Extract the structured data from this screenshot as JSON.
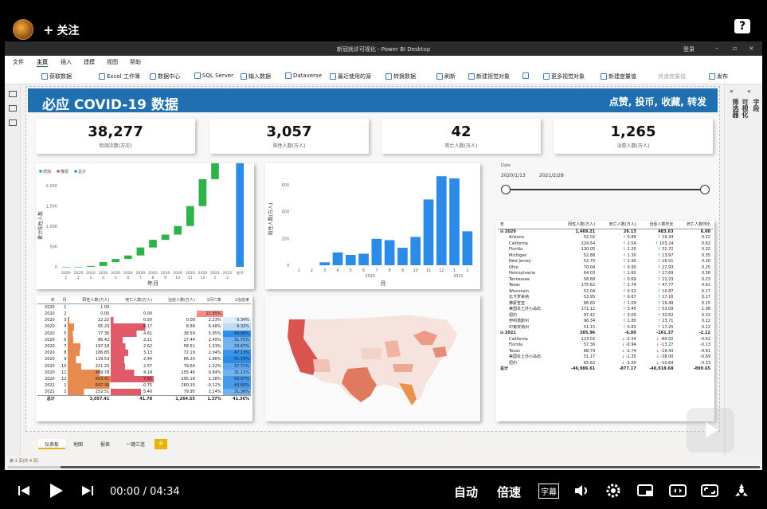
{
  "player": {
    "follow_label": "关注",
    "help": "?",
    "time_current": "00:00",
    "time_sep": "/",
    "time_total": "04:34",
    "auto_label": "自动",
    "speed_label": "倍速",
    "subtitle_label": "字幕",
    "progress_fraction": 0.07
  },
  "window": {
    "title": "新冠就诊可视化 - Power BI Desktop",
    "login": "登录"
  },
  "menu": [
    "文件",
    "主页",
    "插入",
    "建模",
    "视图",
    "帮助"
  ],
  "ribbon": [
    "获取数据",
    "Excel 工作簿",
    "数据中心",
    "SQL Server",
    "输入数据",
    "Dataverse",
    "最近使用的源",
    "转换数据",
    "刷新",
    "新建视觉对象",
    "文本框",
    "更多视觉对象",
    "新建度量值",
    "快速度量值",
    "发布"
  ],
  "right_pane": {
    "viz": "可视化",
    "filters": "筛选器",
    "fields": "字段"
  },
  "dashboard": {
    "title": "必应 COVID-19 数据",
    "cta": "点赞, 投币, 收藏, 转发",
    "kpis": [
      {
        "value": "38,277",
        "label": "检测次数(万次)"
      },
      {
        "value": "3,057",
        "label": "阳性人数(万人)"
      },
      {
        "value": "42",
        "label": "死亡人数(万人)"
      },
      {
        "value": "1,265",
        "label": "治愈人数(万人)"
      }
    ]
  },
  "chart_data": [
    {
      "type": "bar",
      "subtype": "waterfall",
      "legend": [
        "增加",
        "降低",
        "总计"
      ],
      "colors": {
        "increase": "#2fb24a",
        "decrease": "#d9534f",
        "total": "#2b8be6"
      },
      "categories": [
        "2020 1",
        "2020 2",
        "2020 3",
        "2020 4",
        "2020 5",
        "2020 6",
        "2020 7",
        "2020 8",
        "2020 9",
        "2020 10",
        "2020 11",
        "2020 12",
        "2021 1",
        "2021 2",
        "总计"
      ],
      "values": [
        0,
        0,
        22,
        95,
        77,
        86,
        197,
        187,
        130,
        211,
        490,
        663,
        647,
        253,
        3057
      ],
      "xlabel": "年月",
      "ylabel": "累计阳性人数",
      "yticks": [
        "0",
        "500",
        "1,000",
        "1,500",
        "2,000"
      ],
      "ylim": [
        0,
        2000
      ]
    },
    {
      "type": "bar",
      "categories": [
        "2020 1",
        "2020 2",
        "2020 3",
        "2020 4",
        "2020 5",
        "2020 6",
        "2020 7",
        "2020 8",
        "2020 9",
        "2020 10",
        "2020 11",
        "2020 12",
        "2021 1",
        "2021 2"
      ],
      "values": [
        0,
        0,
        22,
        95,
        77,
        86,
        197,
        187,
        130,
        211,
        490,
        663,
        647,
        253
      ],
      "xlabel": "月",
      "ylabel": "阳性人数(万人)",
      "xgroups": [
        "2020",
        "2021"
      ],
      "yticks": [
        "0",
        "200",
        "400",
        "600"
      ],
      "ylim": [
        0,
        700
      ],
      "color": "#2b8be6"
    }
  ],
  "slicer": {
    "label": "Date",
    "from": "2020/1/13",
    "to": "2021/2/28"
  },
  "monthly_table": {
    "headers": [
      "年",
      "月",
      "阳性人数(万人)",
      "死亡人数(万人)",
      "治愈人数(万人)",
      "1月亡率",
      "1治愈率"
    ],
    "rows": [
      [
        "2020",
        "1",
        "1.00",
        "",
        "",
        "",
        ""
      ],
      [
        "2020",
        "2",
        "0.00",
        "0.00",
        "",
        "21.85%",
        ""
      ],
      [
        "2020",
        "3",
        "22.22",
        "0.50",
        "0.08",
        "2.23%",
        "0.34%"
      ],
      [
        "2020",
        "4",
        "95.29",
        "6.17",
        "8.88",
        "6.48%",
        "9.32%"
      ],
      [
        "2020",
        "5",
        "77.36",
        "4.61",
        "38.59",
        "5.95%",
        "49.89%"
      ],
      [
        "2020",
        "6",
        "86.42",
        "2.11",
        "27.44",
        "2.45%",
        "31.75%"
      ],
      [
        "2020",
        "7",
        "197.18",
        "2.62",
        "58.51",
        "1.33%",
        "29.67%"
      ],
      [
        "2020",
        "8",
        "186.85",
        "3.13",
        "72.19",
        "2.04%",
        "47.13%"
      ],
      [
        "2020",
        "9",
        "129.53",
        "2.44",
        "66.25",
        "1.88%",
        "51.14%"
      ],
      [
        "2020",
        "10",
        "211.20",
        "2.57",
        "79.64",
        "1.22%",
        "37.71%"
      ],
      [
        "2020",
        "11",
        "489.78",
        "4.19",
        "155.46",
        "0.84%",
        "31.11%"
      ],
      [
        "2020",
        "12",
        "663.41",
        "7.65",
        "295.18",
        "1.28%",
        "43.07%"
      ],
      [
        "2021",
        "1",
        "647.30",
        "-0.75",
        "280.15",
        "-0.12%",
        "43.60%"
      ],
      [
        "2021",
        "2",
        "252.51",
        "5.40",
        "79.95",
        "2.14%",
        "31.36%"
      ]
    ],
    "total": [
      "总计",
      "",
      "3,057.41",
      "41.78",
      "1,264.55",
      "1.37%",
      "41.36%"
    ]
  },
  "region_table": {
    "headers": [
      "年",
      "阳性人数(万人)",
      "死亡人数(万人)",
      "治愈人数环比",
      "死亡人数环比"
    ],
    "rows": [
      {
        "name": "2020",
        "year": true,
        "v": [
          "1,469.21",
          "26.13",
          "483.63",
          "6.00"
        ],
        "d": [
          "",
          "",
          "",
          ""
        ]
      },
      {
        "name": "Arizona",
        "v": [
          "52.02",
          "0.89",
          "19.34",
          "0.22"
        ],
        "d": [
          "",
          "up",
          "up",
          ""
        ]
      },
      {
        "name": "California",
        "v": [
          "224.54",
          "2.54",
          "103.24",
          "0.62"
        ],
        "d": [
          "",
          "up",
          "up",
          ""
        ]
      },
      {
        "name": "Florida",
        "v": [
          "130.05",
          "2.20",
          "31.72",
          "0.32"
        ],
        "d": [
          "",
          "up",
          "up",
          ""
        ]
      },
      {
        "name": "Michigan",
        "v": [
          "52.88",
          "1.30",
          "13.97",
          "0.35"
        ],
        "d": [
          "",
          "up",
          "up",
          ""
        ]
      },
      {
        "name": "New Jersey",
        "v": [
          "52.70",
          "1.90",
          "16.01",
          "0.20"
        ],
        "d": [
          "",
          "up",
          "up",
          ""
        ]
      },
      {
        "name": "Ohio",
        "v": [
          "70.04",
          "0.90",
          "27.93",
          "0.25"
        ],
        "d": [
          "",
          "up",
          "up",
          ""
        ]
      },
      {
        "name": "Pennsylvania",
        "v": [
          "64.03",
          "1.60",
          "27.69",
          "0.56"
        ],
        "d": [
          "",
          "up",
          "up",
          ""
        ]
      },
      {
        "name": "Tennessee",
        "v": [
          "58.68",
          "0.69",
          "21.23",
          "0.23"
        ],
        "d": [
          "",
          "up",
          "up",
          ""
        ]
      },
      {
        "name": "Texas",
        "v": [
          "175.62",
          "2.74",
          "47.77",
          "0.61"
        ],
        "d": [
          "",
          "up",
          "up",
          ""
        ]
      },
      {
        "name": "Wisconsin",
        "v": [
          "52.04",
          "0.52",
          "10.87",
          "0.17"
        ],
        "d": [
          "",
          "up",
          "up",
          ""
        ]
      },
      {
        "name": "北卡罗来纳",
        "v": [
          "53.95",
          "0.67",
          "17.16",
          "0.17"
        ],
        "d": [
          "",
          "up",
          "up",
          ""
        ]
      },
      {
        "name": "佛蒙查亚",
        "v": [
          "66.65",
          "1.09",
          "19.49",
          "0.15"
        ],
        "d": [
          "",
          "up",
          "up",
          ""
        ]
      },
      {
        "name": "美国本土外小岛屿",
        "v": [
          "171.12",
          "3.45",
          "53.09",
          "1.08"
        ],
        "d": [
          "",
          "up",
          "up",
          ""
        ]
      },
      {
        "name": "纽约",
        "v": [
          "97.42",
          "3.00",
          "32.62",
          "0.33"
        ],
        "d": [
          "",
          "up",
          "up",
          ""
        ]
      },
      {
        "name": "伊利诺斯州",
        "v": [
          "96.34",
          "1.80",
          "23.71",
          "0.22"
        ],
        "d": [
          "",
          "up",
          "up",
          ""
        ]
      },
      {
        "name": "印第安纳州",
        "v": [
          "51.15",
          "0.83",
          "17.25",
          "0.13"
        ],
        "d": [
          "",
          "up",
          "up",
          ""
        ]
      },
      {
        "name": "2021",
        "year": true,
        "v": [
          "385.96",
          "-6.00",
          "-161.37",
          "-2.12"
        ],
        "d": [
          "",
          "",
          "",
          ""
        ]
      },
      {
        "name": "California",
        "v": [
          "123.02",
          "-2.54",
          "-80.02",
          "-0.62"
        ],
        "d": [
          "",
          "dn",
          "dn",
          ""
        ]
      },
      {
        "name": "Florida",
        "v": [
          "57.36",
          "-0.94",
          "-13.27",
          "-0.13"
        ],
        "d": [
          "",
          "dn",
          "dn",
          ""
        ]
      },
      {
        "name": "Texas",
        "v": [
          "88.79",
          "-2.74",
          "-19.43",
          "-0.61"
        ],
        "d": [
          "",
          "dn",
          "dn",
          ""
        ]
      },
      {
        "name": "美国本土外小岛屿",
        "v": [
          "51.17",
          "-1.35",
          "-38.00",
          "-0.69"
        ],
        "d": [
          "",
          "dn",
          "dn",
          ""
        ]
      },
      {
        "name": "纽约",
        "v": [
          "65.62",
          "-3.00",
          "-10.64",
          "-0.33"
        ],
        "d": [
          "",
          "dn",
          "dn",
          ""
        ]
      },
      {
        "name": "总计",
        "year": true,
        "v": [
          "-46,986.61",
          "-877.17",
          "-48,918.68",
          "-899.65"
        ],
        "d": [
          "",
          "",
          "",
          ""
        ]
      }
    ]
  },
  "pages": [
    "仪表板",
    "地图",
    "报表",
    "一键三连"
  ],
  "status": "第 1 页(共 4 页)"
}
